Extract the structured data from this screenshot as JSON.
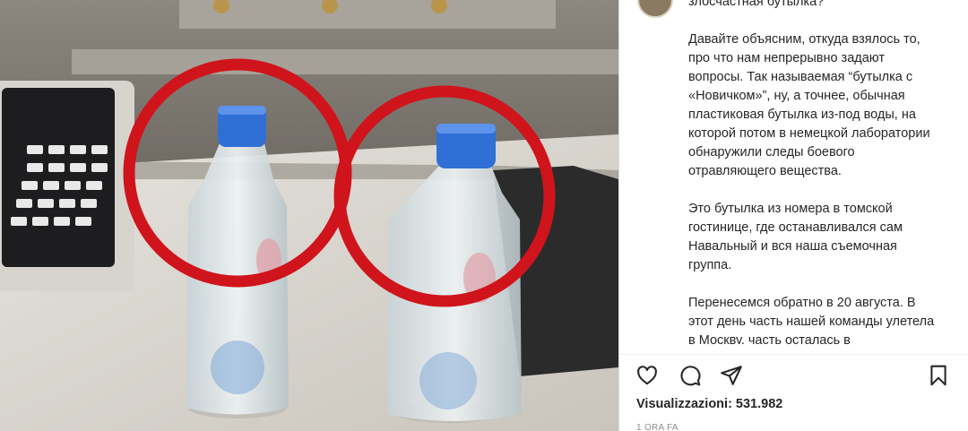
{
  "post": {
    "caption_paragraphs": [
      "злосчастная бутылка?",
      "Давайте объясним, откуда взялось то, про что нам непрерывно задают вопросы. Так называемая “бутылка с «Новичком»”, ну, а точнее, обычная пластиковая бутылка из-под воды, на которой потом в немецкой лаборатории обнаружили следы боевого отравляющего вещества.",
      "Это бутылка из номера в томской гостинице, где останавливался сам Навальный и вся наша съемочная группа.",
      "Перенесемся обратно в 20 августа. В этот день часть нашей команды улетела в Москву, часть осталась в"
    ],
    "views_label": "Visualizzazioni: 531.982",
    "timestamp": "1 ORA FA"
  },
  "icons": {
    "like": "heart-icon",
    "comment": "comment-icon",
    "share": "paper-plane-icon",
    "save": "bookmark-icon"
  },
  "colors": {
    "highlight_circle": "#d0141c",
    "bottle_cap": "#2f6fd6"
  }
}
